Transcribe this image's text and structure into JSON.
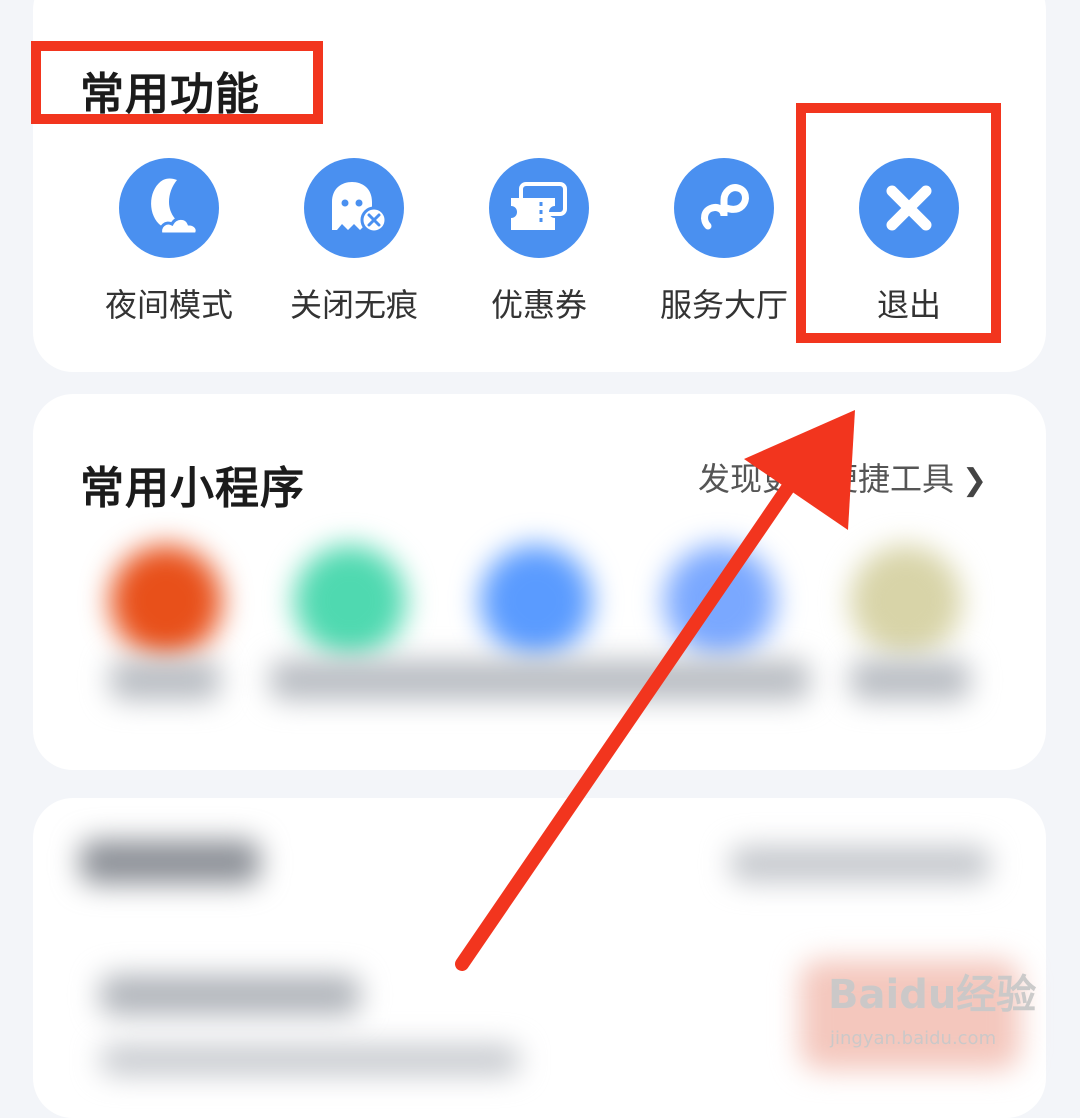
{
  "common_functions": {
    "title": "常用功能",
    "items": [
      {
        "label": "夜间模式",
        "icon": "night-mode-icon"
      },
      {
        "label": "关闭无痕",
        "icon": "ghost-close-icon"
      },
      {
        "label": "优惠券",
        "icon": "coupon-icon"
      },
      {
        "label": "服务大厅",
        "icon": "service-hall-icon"
      },
      {
        "label": "退出",
        "icon": "close-icon"
      }
    ]
  },
  "mini_programs": {
    "title": "常用小程序",
    "discover_link": "发现更多便捷工具"
  },
  "watermark": {
    "brand": "Baidu经验",
    "url": "jingyan.baidu.com"
  },
  "colors": {
    "accent_blue": "#4a90f0",
    "annotation_red": "#f2351e"
  }
}
